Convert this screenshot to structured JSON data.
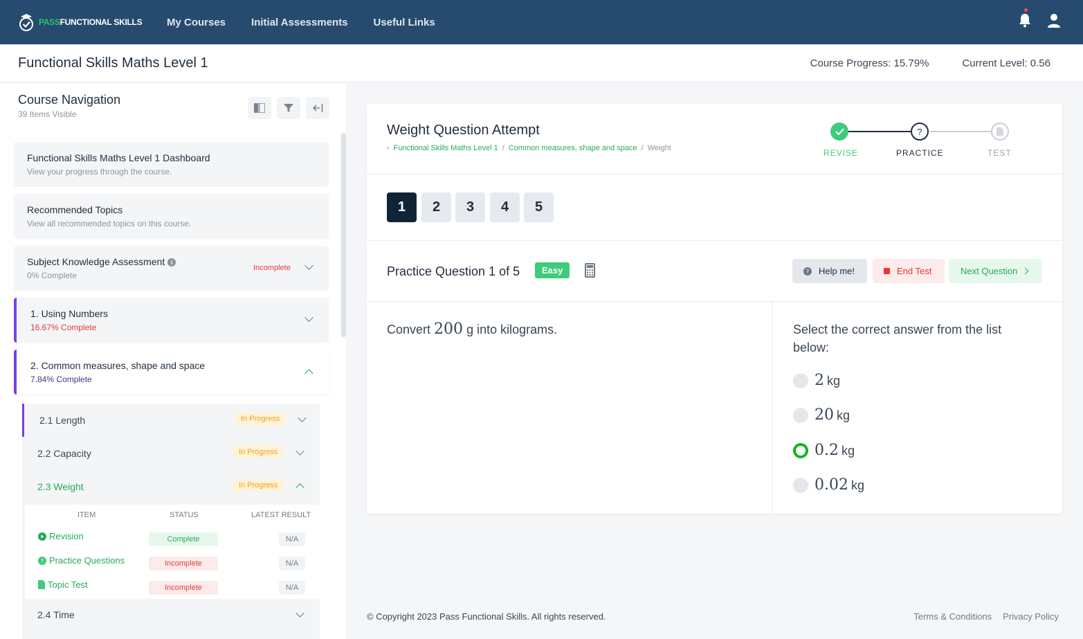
{
  "nav": {
    "logo_pass": "PASS",
    "logo_rest": "FUNCTIONAL SKILLS",
    "links": [
      "My Courses",
      "Initial Assessments",
      "Useful Links"
    ]
  },
  "header": {
    "course_title": "Functional Skills Maths Level 1",
    "progress": "Course Progress: 15.79%",
    "level": "Current Level: 0.56"
  },
  "sidebar": {
    "title": "Course Navigation",
    "subtitle": "39 Items Visible",
    "cards": [
      {
        "title": "Functional Skills Maths Level 1 Dashboard",
        "sub": "View your progress through the course."
      },
      {
        "title": "Recommended Topics",
        "sub": "View all recommended topics on this course."
      },
      {
        "title": "Subject Knowledge Assessment",
        "sub": "0% Complete",
        "status": "Incomplete"
      },
      {
        "title": "1. Using Numbers",
        "sub": "16.67% Complete"
      },
      {
        "title": "2. Common measures, shape and space",
        "sub": "7.84% Complete"
      }
    ],
    "subtopics": [
      {
        "label": "2.1 Length",
        "status": "In Progress"
      },
      {
        "label": "2.2 Capacity",
        "status": "In Progress"
      },
      {
        "label": "2.3 Weight",
        "status": "In Progress"
      },
      {
        "label": "2.4 Time"
      }
    ],
    "table": {
      "headers": [
        "ITEM",
        "STATUS",
        "LATEST RESULT"
      ],
      "rows": [
        {
          "item": "Revision",
          "status": "Complete",
          "result": "N/A"
        },
        {
          "item": "Practice Questions",
          "status": "Incomplete",
          "result": "N/A"
        },
        {
          "item": "Topic Test",
          "status": "Incomplete",
          "result": "N/A"
        }
      ]
    }
  },
  "main": {
    "title": "Weight Question Attempt",
    "breadcrumb": [
      "Functional Skills Maths Level 1",
      "Common measures, shape and space",
      "Weight"
    ],
    "steps": [
      {
        "label": "REVISE"
      },
      {
        "label": "PRACTICE",
        "symbol": "?"
      },
      {
        "label": "TEST"
      }
    ],
    "question_numbers": [
      "1",
      "2",
      "3",
      "4",
      "5"
    ],
    "practice_title": "Practice Question 1 of 5",
    "difficulty": "Easy",
    "buttons": {
      "help": "Help me!",
      "end": "End Test",
      "next": "Next Question"
    },
    "question": {
      "pre": "Convert",
      "value": "200",
      "post": "g into kilograms."
    },
    "instruction": "Select the correct answer from the list below:",
    "options": [
      {
        "value": "2",
        "unit": "kg",
        "selected": false
      },
      {
        "value": "20",
        "unit": "kg",
        "selected": false
      },
      {
        "value": "0.2",
        "unit": "kg",
        "selected": true
      },
      {
        "value": "0.02",
        "unit": "kg",
        "selected": false
      }
    ]
  },
  "footer": {
    "copyright": "© Copyright 2023 Pass Functional Skills. All rights reserved.",
    "terms": "Terms & Conditions",
    "privacy": "Privacy Policy"
  },
  "colors": {
    "nav_bg": "#264b6e",
    "accent_green": "#27a85a",
    "accent_purple": "#7b3fe4",
    "danger": "#e53935"
  }
}
